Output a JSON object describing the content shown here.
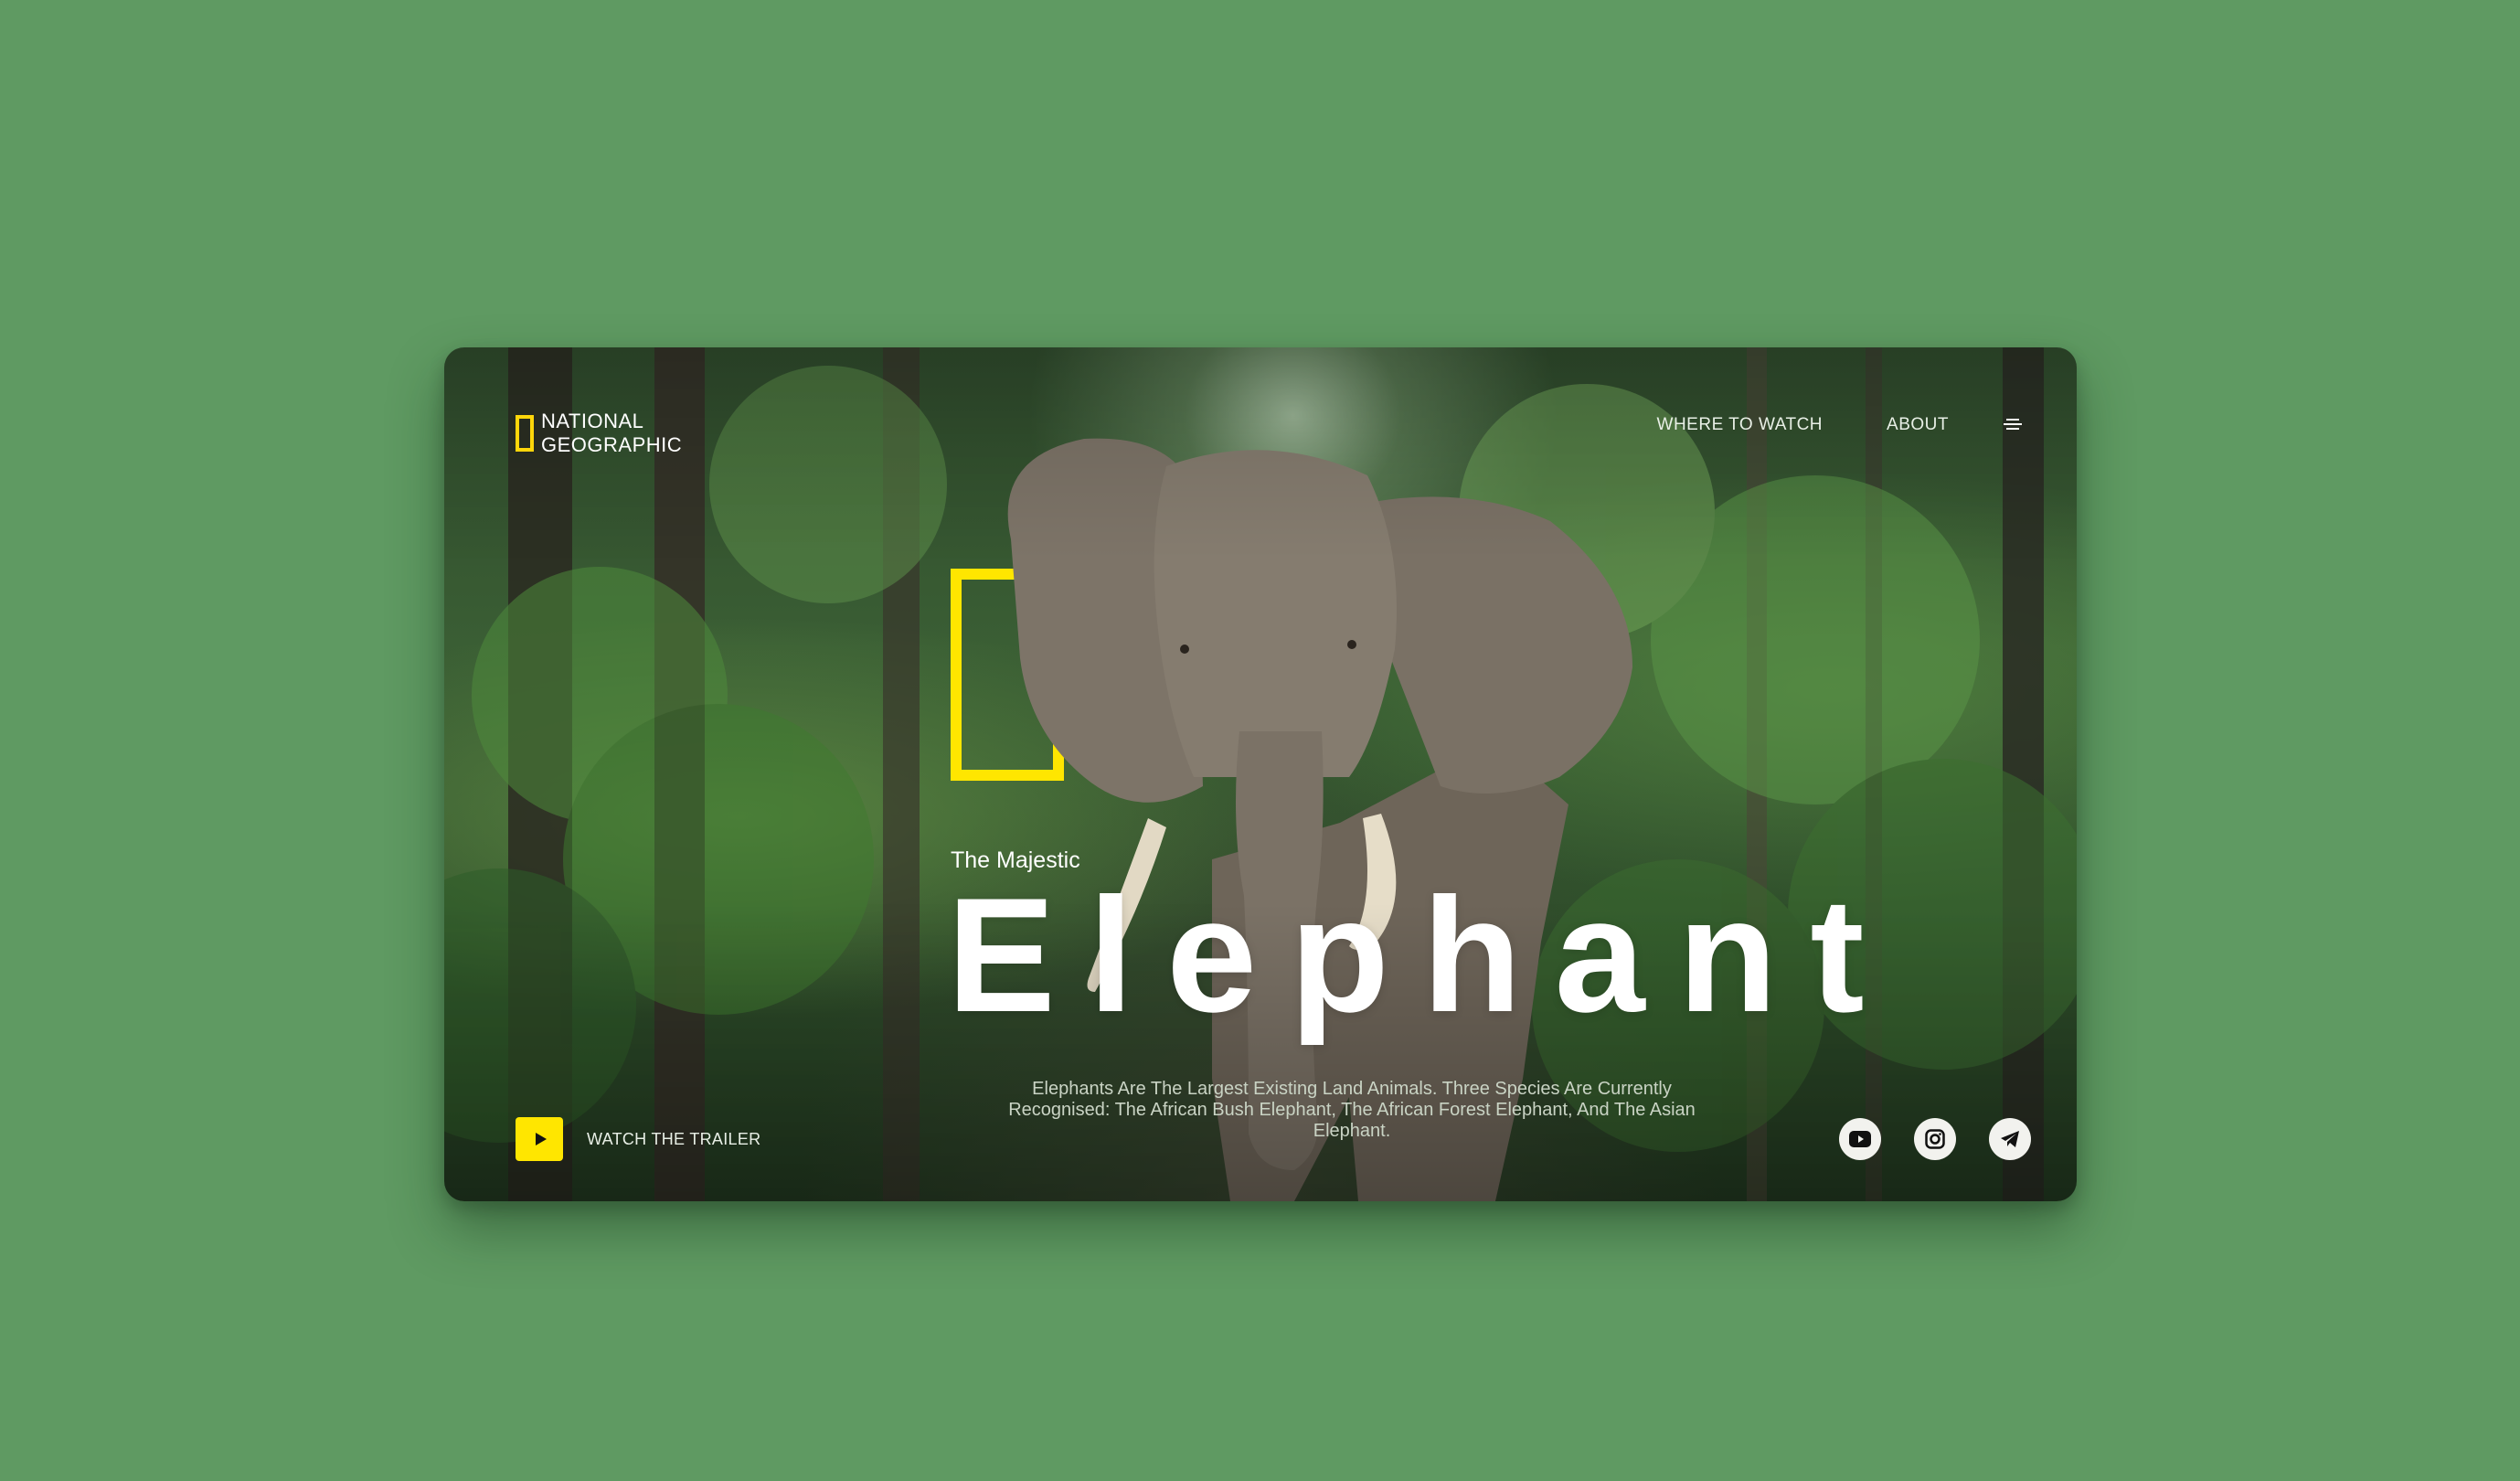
{
  "brand": {
    "line1": "NATIONAL",
    "line2": "GEOGRAPHIC",
    "accent_color": "#ffe600"
  },
  "nav": {
    "items": [
      {
        "label": "WHERE TO WATCH"
      },
      {
        "label": "ABOUT"
      }
    ],
    "menu_icon": "hamburger-menu-icon"
  },
  "hero": {
    "subtitle": "The Majestic",
    "title": "Elephant",
    "description": "Elephants Are The Largest Existing Land Animals. Three Species Are Currently Recognised: The African Bush Elephant, The African Forest Elephant, And The Asian Elephant."
  },
  "cta": {
    "label": "WATCH THE TRAILER",
    "icon": "play-icon"
  },
  "socials": [
    {
      "icon": "youtube-icon"
    },
    {
      "icon": "instagram-icon"
    },
    {
      "icon": "telegram-icon"
    }
  ],
  "colors": {
    "page_background": "#5f9a62",
    "text": "#ffffff"
  }
}
